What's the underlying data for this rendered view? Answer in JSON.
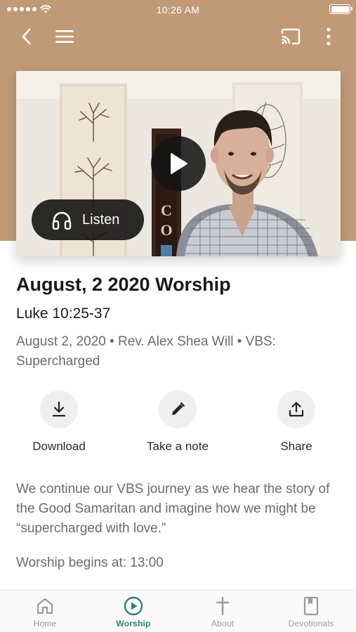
{
  "colors": {
    "header_background": "#c09a77",
    "accent": "#2e7f80",
    "overlay": "#141414"
  },
  "status_bar": {
    "time": "10:26 AM",
    "signal_icon": "signal-dots-icon",
    "wifi_icon": "wifi-icon",
    "battery_icon": "battery-icon"
  },
  "nav": {
    "back_icon": "back-chevron-icon",
    "menu_icon": "hamburger-menu-icon",
    "cast_icon": "cast-icon",
    "more_icon": "more-vertical-icon"
  },
  "video": {
    "play_icon": "play-icon",
    "listen_label": "Listen",
    "listen_icon": "headphones-icon"
  },
  "sermon": {
    "title": "August, 2 2020 Worship",
    "scripture": "Luke 10:25-37",
    "meta": "August 2, 2020 • Rev. Alex Shea Will • VBS: Supercharged",
    "description": "We continue our VBS journey as we hear the story of the Good Samaritan and imagine how we might be “supercharged with love.”",
    "schedule": "Worship begins at: 13:00"
  },
  "actions": [
    {
      "label": "Download",
      "icon": "download-icon"
    },
    {
      "label": "Take a note",
      "icon": "pencil-icon"
    },
    {
      "label": "Share",
      "icon": "share-icon"
    }
  ],
  "tabs": [
    {
      "label": "Home",
      "icon": "home-icon",
      "active": false
    },
    {
      "label": "Worship",
      "icon": "play-circle-icon",
      "active": true
    },
    {
      "label": "About",
      "icon": "cross-icon",
      "active": false
    },
    {
      "label": "Devotionals",
      "icon": "bookmark-book-icon",
      "active": false
    }
  ]
}
